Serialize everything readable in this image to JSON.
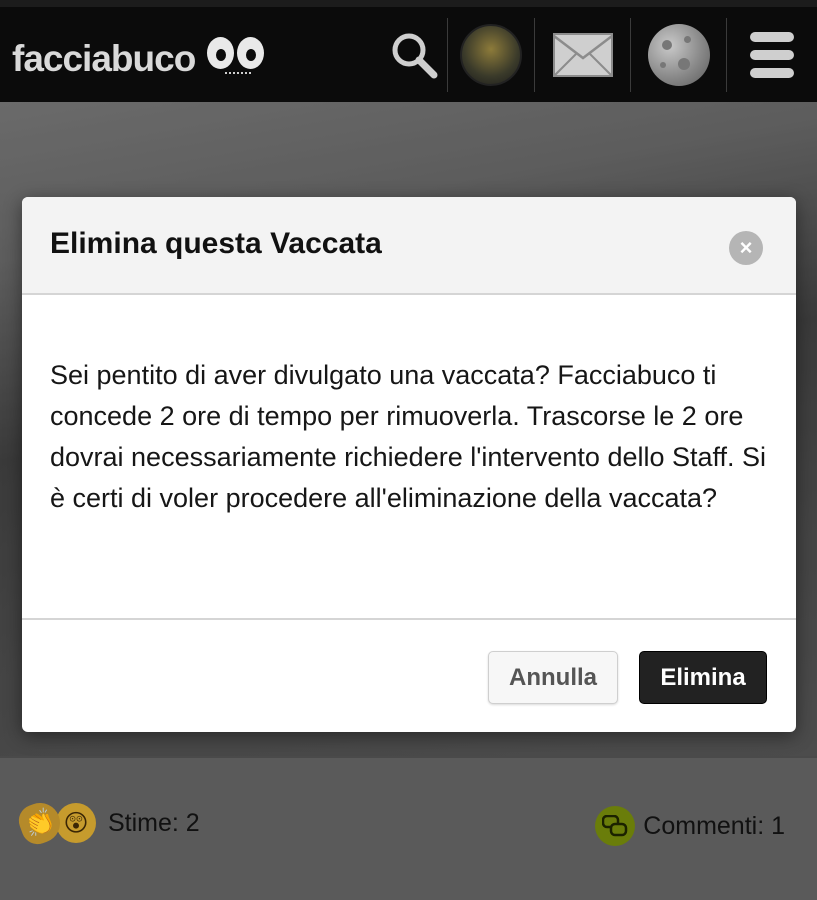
{
  "header": {
    "logo_text": "facciabuco",
    "icons": [
      "search-icon",
      "profile-avatar",
      "mail-icon",
      "moon-icon",
      "menu-icon"
    ]
  },
  "modal": {
    "title": "Elimina questa Vaccata",
    "close_label": "×",
    "body": "Sei pentito di aver divulgato una vaccata? Facciabuco ti concede 2 ore di tempo per rimuoverla. Trascorse le 2 ore dovrai necessariamente richiedere l'intervento dello Staff. Si è certi di voler procedere all'eliminazione della vaccata?",
    "cancel_label": "Annulla",
    "confirm_label": "Elimina"
  },
  "post": {
    "stime_label": "Stime: 2",
    "commenti_label": "Commenti: 1"
  },
  "colors": {
    "navbar": "#0b0b0b",
    "confirm_button": "#222222",
    "comment_icon": "#6a7d0a"
  }
}
